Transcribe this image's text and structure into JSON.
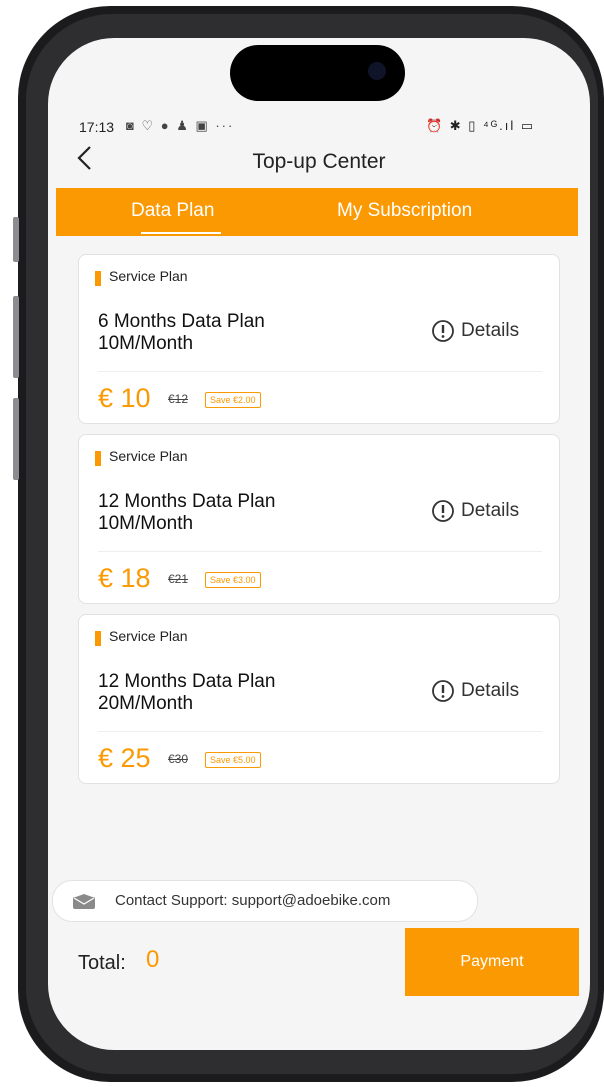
{
  "status_bar": {
    "time": "17:13",
    "app_icons": "◙ ♡ ● ♟ ▣ ···",
    "right_icons": "⏰ ✱ ▯ ⁴ᴳ.ıl ▭"
  },
  "header": {
    "title": "Top-up Center",
    "back_icon": "chevron-left-icon"
  },
  "tabs": [
    {
      "label": "Data Plan",
      "active": true
    },
    {
      "label": "My Subscription",
      "active": false
    }
  ],
  "plans": [
    {
      "tag": "Service Plan",
      "title": "6 Months Data Plan\n10M/Month",
      "details_label": "Details",
      "price": "€ 10",
      "old_price": "€12",
      "save": "Save €2.00"
    },
    {
      "tag": "Service Plan",
      "title": "12 Months Data Plan\n10M/Month",
      "details_label": "Details",
      "price": "€ 18",
      "old_price": "€21",
      "save": "Save €3.00"
    },
    {
      "tag": "Service Plan",
      "title": "12 Months Data Plan\n20M/Month",
      "details_label": "Details",
      "price": "€ 25",
      "old_price": "€30",
      "save": "Save €5.00"
    }
  ],
  "contact": {
    "text": "Contact Support: support@adoebike.com",
    "icon": "mail-icon"
  },
  "footer": {
    "total_label": "Total:",
    "total_value": "0",
    "pay_label": "Payment"
  },
  "colors": {
    "accent": "#fb9902",
    "background": "#f5f5f5"
  }
}
